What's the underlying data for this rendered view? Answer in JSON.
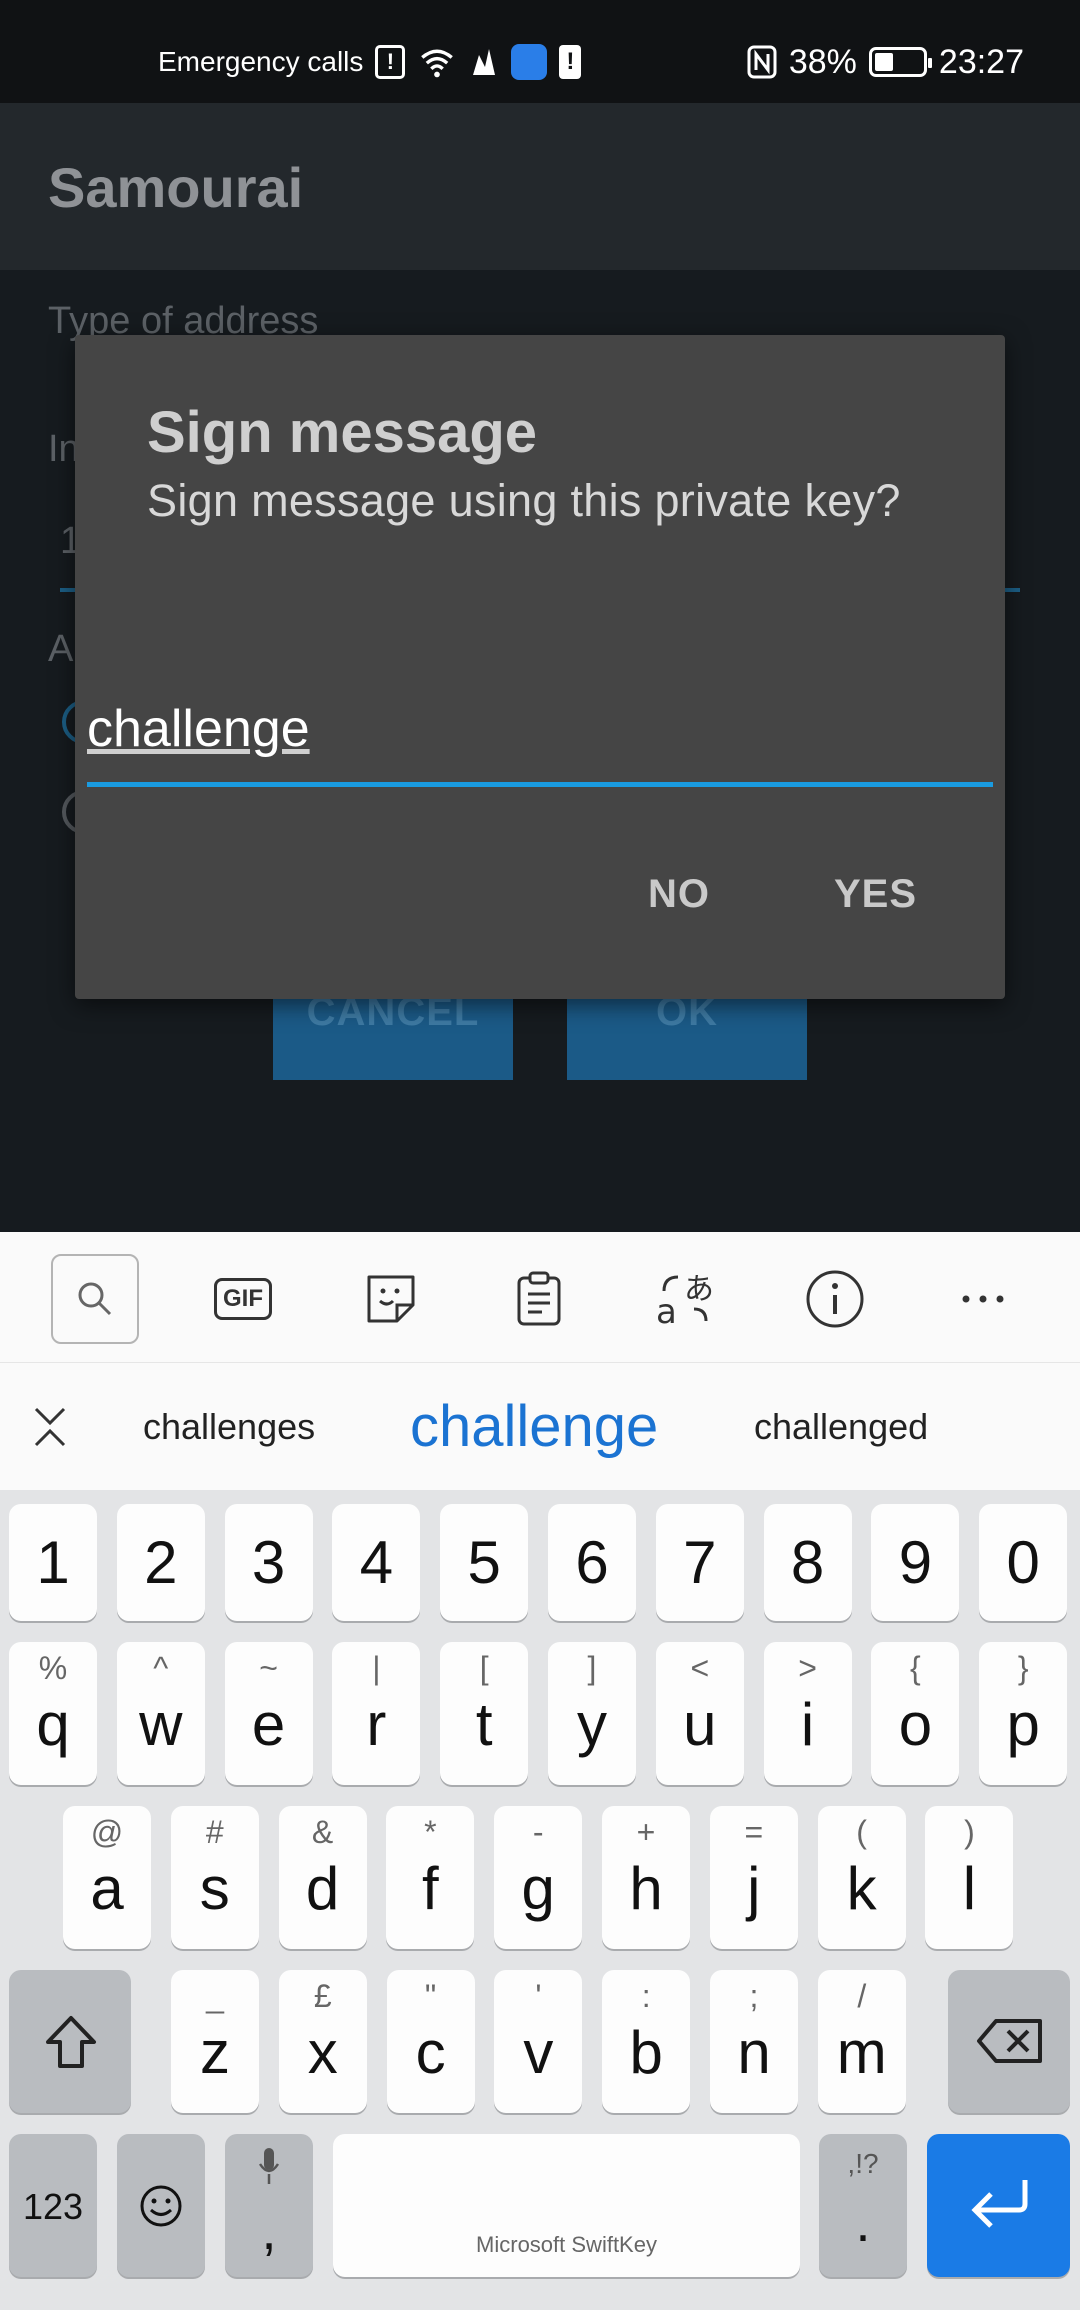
{
  "status_bar": {
    "carrier_text": "Emergency calls",
    "alert_glyph": "!",
    "battery_percent": "38%",
    "time": "23:27",
    "icons": [
      "sim-alert-icon",
      "wifi-icon",
      "bird-app-icon",
      "blue-app-icon",
      "alert-icon",
      "nfc-icon",
      "battery-icon"
    ]
  },
  "app": {
    "title": "Samourai",
    "type_label": "Type of address",
    "input_label_fragment": "In",
    "input_value_fragment": "1",
    "address_label_fragment": "A",
    "cancel_label": "CANCEL",
    "ok_label": "OK"
  },
  "dialog": {
    "title": "Sign message",
    "message": "Sign message using this private key?",
    "input_value": "challenge",
    "no_label": "NO",
    "yes_label": "YES"
  },
  "keyboard": {
    "toolbar_icons": [
      "search-icon",
      "gif-icon",
      "sticker-icon",
      "clipboard-icon",
      "translate-icon",
      "info-icon",
      "more-icon"
    ],
    "gif_label": "GIF",
    "suggestions": [
      "challenges",
      "challenge",
      "challenged"
    ],
    "number_row": [
      "1",
      "2",
      "3",
      "4",
      "5",
      "6",
      "7",
      "8",
      "9",
      "0"
    ],
    "row1": [
      {
        "main": "q",
        "sec": "%"
      },
      {
        "main": "w",
        "sec": "^"
      },
      {
        "main": "e",
        "sec": "~"
      },
      {
        "main": "r",
        "sec": "|"
      },
      {
        "main": "t",
        "sec": "["
      },
      {
        "main": "y",
        "sec": "]"
      },
      {
        "main": "u",
        "sec": "<"
      },
      {
        "main": "i",
        "sec": ">"
      },
      {
        "main": "o",
        "sec": "{"
      },
      {
        "main": "p",
        "sec": "}"
      }
    ],
    "row2": [
      {
        "main": "a",
        "sec": "@"
      },
      {
        "main": "s",
        "sec": "#"
      },
      {
        "main": "d",
        "sec": "&"
      },
      {
        "main": "f",
        "sec": "*"
      },
      {
        "main": "g",
        "sec": "-"
      },
      {
        "main": "h",
        "sec": "+"
      },
      {
        "main": "j",
        "sec": "="
      },
      {
        "main": "k",
        "sec": "("
      },
      {
        "main": "l",
        "sec": ")"
      }
    ],
    "row3": [
      {
        "main": "z",
        "sec": "_"
      },
      {
        "main": "x",
        "sec": "£"
      },
      {
        "main": "c",
        "sec": "\""
      },
      {
        "main": "v",
        "sec": "'"
      },
      {
        "main": "b",
        "sec": ":"
      },
      {
        "main": "n",
        "sec": ";"
      },
      {
        "main": "m",
        "sec": "/"
      }
    ],
    "numbers_key": "123",
    "comma_key": ",",
    "space_label": "Microsoft SwiftKey",
    "period_sec": ",!?",
    "period_key": ".",
    "accent_color": "#1a7be6"
  }
}
